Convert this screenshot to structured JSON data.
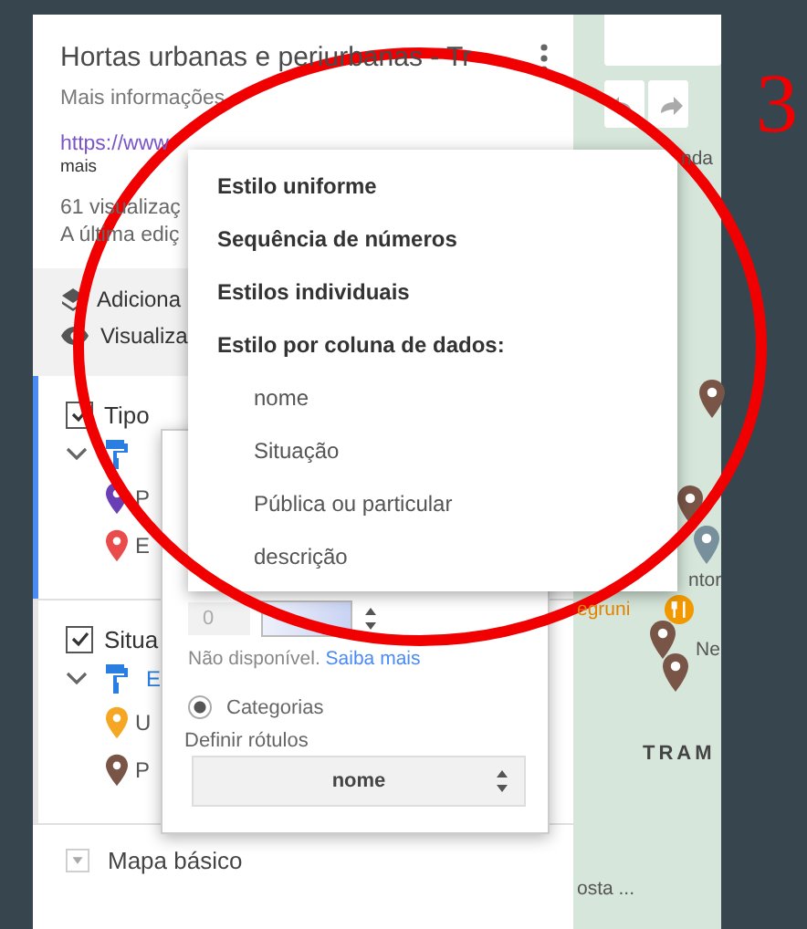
{
  "sidebar": {
    "title": "Hortas urbanas e periurbanas - Tr",
    "subtitle": "Mais informações",
    "link": "https://www",
    "more": "mais",
    "views": "61 visualizaç",
    "last_edit": "A última ediç",
    "actions": [
      {
        "kind": "add",
        "label": "Adiciona"
      },
      {
        "kind": "preview",
        "label": "Visualiza"
      }
    ],
    "layers": [
      {
        "name": "Tipo",
        "checked": true,
        "selected": true,
        "items": [
          {
            "label": "P",
            "color": "#6a3fb5"
          },
          {
            "label": "E",
            "color": "#ea4c4c"
          }
        ]
      },
      {
        "name": "Situa",
        "checked": true,
        "selected": false,
        "style_label": "E",
        "items": [
          {
            "label": "U",
            "color": "#f5a623"
          },
          {
            "label": "P",
            "color": "#795548"
          }
        ]
      }
    ],
    "base_map": "Mapa básico"
  },
  "style_panel": {
    "range_value": "0",
    "unavailable": "Não disponível.",
    "learn_more": "Saiba mais",
    "options": [
      {
        "label": "Categorias",
        "selected": true
      }
    ],
    "labels_heading": "Definir rótulos",
    "labels_value": "nome"
  },
  "style_menu": {
    "items": [
      {
        "label": "Estilo uniforme",
        "kind": "option"
      },
      {
        "label": "Sequência de números",
        "kind": "option"
      },
      {
        "label": "Estilos individuais",
        "kind": "option"
      },
      {
        "label": "Estilo por coluna de dados:",
        "kind": "heading"
      },
      {
        "label": "nome",
        "kind": "column"
      },
      {
        "label": "Situação",
        "kind": "column"
      },
      {
        "label": "Pública ou particular",
        "kind": "column"
      },
      {
        "label": "descrição",
        "kind": "column"
      }
    ]
  },
  "map": {
    "labels": [
      {
        "text": "nda",
        "kind": "place"
      },
      {
        "text": "ntor",
        "kind": "place"
      },
      {
        "text": "egruni",
        "kind": "poi"
      },
      {
        "text": "Ne",
        "kind": "place"
      },
      {
        "text": "TRAM",
        "kind": "district"
      },
      {
        "text": "osta ...",
        "kind": "place"
      }
    ]
  },
  "annotation": {
    "number": "3"
  }
}
